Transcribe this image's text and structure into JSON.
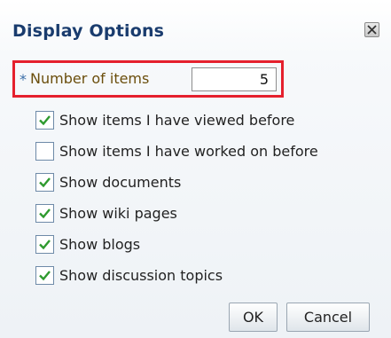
{
  "dialog": {
    "title": "Display Options",
    "close_icon": "close-icon"
  },
  "number_field": {
    "required_marker": "*",
    "label": "Number of items",
    "value": "5"
  },
  "options": [
    {
      "label": "Show items I have viewed before",
      "checked": true
    },
    {
      "label": "Show items I have worked on before",
      "checked": false
    },
    {
      "label": "Show documents",
      "checked": true
    },
    {
      "label": "Show wiki pages",
      "checked": true
    },
    {
      "label": "Show blogs",
      "checked": true
    },
    {
      "label": "Show discussion topics",
      "checked": true
    }
  ],
  "buttons": {
    "ok": "OK",
    "cancel": "Cancel"
  },
  "colors": {
    "title": "#1a3c6e",
    "highlight_border": "#e5202d",
    "checkmark": "#2e9a2e"
  }
}
